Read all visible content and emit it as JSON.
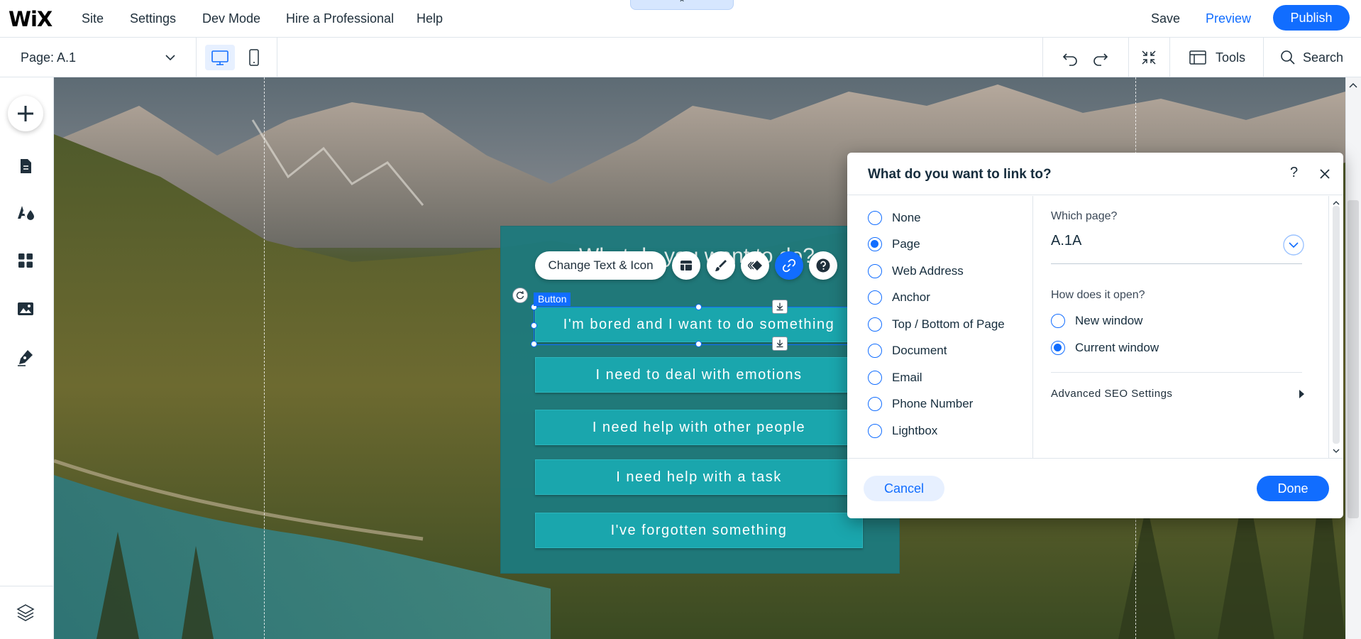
{
  "app": {
    "logo": "WiX"
  },
  "menu": {
    "items": [
      "Site",
      "Settings",
      "Dev Mode",
      "Hire a Professional",
      "Help"
    ],
    "save": "Save",
    "preview": "Preview",
    "publish": "Publish",
    "collapse_glyph": "⌃"
  },
  "toolbar": {
    "page_label": "Page: A.1",
    "tools_label": "Tools",
    "search_label": "Search"
  },
  "canvas": {
    "section_title": "What do you want to do?",
    "buttons": [
      "I'm bored and I want to do something",
      "I need to deal with emotions",
      "I need help with other people",
      "I need help with a task",
      "I've forgotten something"
    ],
    "selected_tag": "Button"
  },
  "element_toolbar": {
    "change_text_icon": "Change Text & Icon"
  },
  "link_dialog": {
    "title": "What do you want to link to?",
    "help": "?",
    "options": [
      "None",
      "Page",
      "Web Address",
      "Anchor",
      "Top / Bottom of Page",
      "Document",
      "Email",
      "Phone Number",
      "Lightbox"
    ],
    "selected_option": "Page",
    "which_page_label": "Which page?",
    "which_page_value": "A.1A",
    "how_open_label": "How does it open?",
    "open_options": [
      "New window",
      "Current window"
    ],
    "open_selected": "Current window",
    "advanced_seo": "Advanced SEO Settings",
    "cancel": "Cancel",
    "done": "Done"
  },
  "colors": {
    "accent": "#116dff",
    "teal_box": "#1d7a7e",
    "site_button": "#1aa6ad"
  }
}
